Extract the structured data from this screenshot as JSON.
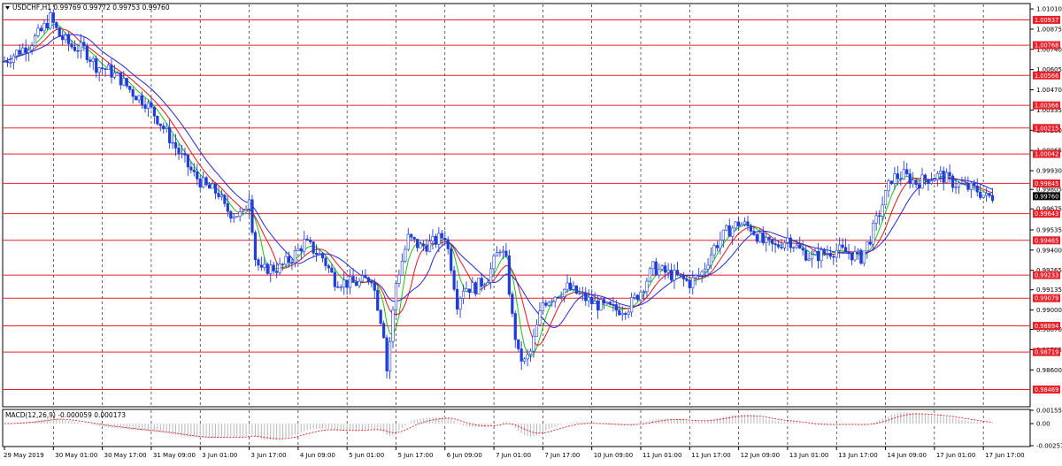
{
  "header": {
    "title": "USDCHF,H1  0.99769 0.99772 0.99753 0.99760",
    "menu_icon": "triangle-down-icon"
  },
  "colors": {
    "background": "#ffffff",
    "candle": "#1f3dd8",
    "ma_fast": "#16c60c",
    "ma_mid": "#e0161b",
    "ma_slow": "#2326d6",
    "level_line": "#e8202a",
    "level_label_bg": "#e8202a",
    "current_label_bg": "#000000",
    "grid": "#000000",
    "macd_hist": "#b8b8b8",
    "macd_signal": "#e02020"
  },
  "macd": {
    "label": "MACD(12,26,9) -0.000059 0.000173",
    "ticks": [
      "0.001553",
      "0.00",
      "-0.002571"
    ],
    "tick_values": [
      0.001553,
      0,
      -0.002571
    ],
    "ylim": [
      -0.002571,
      0.001553
    ]
  },
  "chart_data": {
    "type": "candlestick",
    "symbol": "USDCHF",
    "timeframe": "H1",
    "ylim": [
      0.9836,
      1.0104
    ],
    "y_ticks": [
      "1.01010",
      "1.00875",
      "1.00740",
      "1.00605",
      "1.00470",
      "1.00335",
      "1.00200",
      "1.00065",
      "0.99930",
      "0.99805",
      "0.99675",
      "0.99535",
      "0.99400",
      "0.99265",
      "0.99135",
      "0.99000",
      "0.98870",
      "0.98735",
      "0.98600"
    ],
    "y_tick_values": [
      1.0101,
      1.00875,
      1.0074,
      1.00605,
      1.0047,
      1.00335,
      1.002,
      1.00065,
      0.9993,
      0.99805,
      0.99675,
      0.99535,
      0.994,
      0.99265,
      0.99135,
      0.99,
      0.9887,
      0.98735,
      0.986
    ],
    "level_lines": [
      "1.00937",
      "1.00768",
      "1.00566",
      "1.00366",
      "1.00215",
      "1.00042",
      "0.99845",
      "0.99643",
      "0.99465",
      "0.99233",
      "0.99079",
      "0.98894",
      "0.98719",
      "0.98469"
    ],
    "level_values": [
      1.00937,
      1.00768,
      1.00566,
      1.00366,
      1.00215,
      1.00042,
      0.99845,
      0.99643,
      0.99465,
      0.99233,
      0.99079,
      0.98894,
      0.98719,
      0.98469
    ],
    "current_price": "0.99760",
    "current_value": 0.9976,
    "x_labels": [
      "29 May 2019",
      "30 May 01:00",
      "30 May 17:00",
      "31 May 09:00",
      "3 Jun 01:00",
      "3 Jun 17:00",
      "4 Jun 09:00",
      "5 Jun 01:00",
      "5 Jun 17:00",
      "6 Jun 09:00",
      "7 Jun 01:00",
      "7 Jun 17:00",
      "10 Jun 09:00",
      "11 Jun 01:00",
      "11 Jun 17:00",
      "12 Jun 09:00",
      "13 Jun 01:00",
      "13 Jun 17:00",
      "14 Jun 09:00",
      "17 Jun 01:00",
      "17 Jun 17:00"
    ],
    "x_positions": [
      0,
      16,
      32,
      48,
      64,
      80,
      96,
      112,
      128,
      144,
      160,
      176,
      192,
      208,
      224,
      240,
      256,
      272,
      288,
      304,
      320
    ],
    "xlim": [
      0,
      335
    ],
    "grid": true,
    "price_path": [
      [
        0,
        1.0066
      ],
      [
        4,
        1.0072
      ],
      [
        8,
        1.0077
      ],
      [
        12,
        1.0086
      ],
      [
        15,
        1.0095
      ],
      [
        18,
        1.0083
      ],
      [
        22,
        1.0076
      ],
      [
        26,
        1.0074
      ],
      [
        30,
        1.0063
      ],
      [
        34,
        1.006
      ],
      [
        38,
        1.0054
      ],
      [
        42,
        1.0045
      ],
      [
        46,
        1.0039
      ],
      [
        50,
        1.0028
      ],
      [
        54,
        1.0015
      ],
      [
        58,
        1.0002
      ],
      [
        62,
        0.999
      ],
      [
        66,
        0.9982
      ],
      [
        70,
        0.9978
      ],
      [
        72,
        0.9968
      ],
      [
        74,
        0.9965
      ],
      [
        78,
        0.9963
      ],
      [
        80,
        0.9977
      ],
      [
        82,
        0.9935
      ],
      [
        84,
        0.9925
      ],
      [
        86,
        0.9928
      ],
      [
        90,
        0.9928
      ],
      [
        94,
        0.9935
      ],
      [
        98,
        0.9945
      ],
      [
        100,
        0.9942
      ],
      [
        104,
        0.9935
      ],
      [
        108,
        0.992
      ],
      [
        112,
        0.9918
      ],
      [
        116,
        0.9918
      ],
      [
        120,
        0.9922
      ],
      [
        124,
        0.9885
      ],
      [
        125,
        0.986
      ],
      [
        128,
        0.9918
      ],
      [
        132,
        0.9948
      ],
      [
        136,
        0.9942
      ],
      [
        140,
        0.9945
      ],
      [
        144,
        0.995
      ],
      [
        146,
        0.993
      ],
      [
        148,
        0.9905
      ],
      [
        150,
        0.9915
      ],
      [
        154,
        0.9915
      ],
      [
        158,
        0.9922
      ],
      [
        162,
        0.9942
      ],
      [
        164,
        0.9932
      ],
      [
        166,
        0.9895
      ],
      [
        168,
        0.987
      ],
      [
        170,
        0.9865
      ],
      [
        172,
        0.9872
      ],
      [
        176,
        0.9905
      ],
      [
        180,
        0.991
      ],
      [
        184,
        0.9915
      ],
      [
        188,
        0.991
      ],
      [
        192,
        0.9905
      ],
      [
        196,
        0.9902
      ],
      [
        200,
        0.99
      ],
      [
        204,
        0.9902
      ],
      [
        208,
        0.9913
      ],
      [
        212,
        0.9928
      ],
      [
        216,
        0.9925
      ],
      [
        220,
        0.9922
      ],
      [
        224,
        0.9918
      ],
      [
        228,
        0.9925
      ],
      [
        232,
        0.9942
      ],
      [
        236,
        0.9952
      ],
      [
        240,
        0.9958
      ],
      [
        244,
        0.9955
      ],
      [
        248,
        0.9945
      ],
      [
        252,
        0.9942
      ],
      [
        256,
        0.9948
      ],
      [
        260,
        0.994
      ],
      [
        264,
        0.9935
      ],
      [
        268,
        0.9938
      ],
      [
        272,
        0.994
      ],
      [
        276,
        0.9938
      ],
      [
        280,
        0.9935
      ],
      [
        283,
        0.9948
      ],
      [
        286,
        0.9965
      ],
      [
        290,
        0.9988
      ],
      [
        294,
        0.999
      ],
      [
        298,
        0.9985
      ],
      [
        302,
        0.9988
      ],
      [
        306,
        0.999
      ],
      [
        310,
        0.9985
      ],
      [
        314,
        0.9982
      ],
      [
        318,
        0.998
      ],
      [
        321,
        0.9975
      ],
      [
        323,
        0.9976
      ]
    ]
  }
}
